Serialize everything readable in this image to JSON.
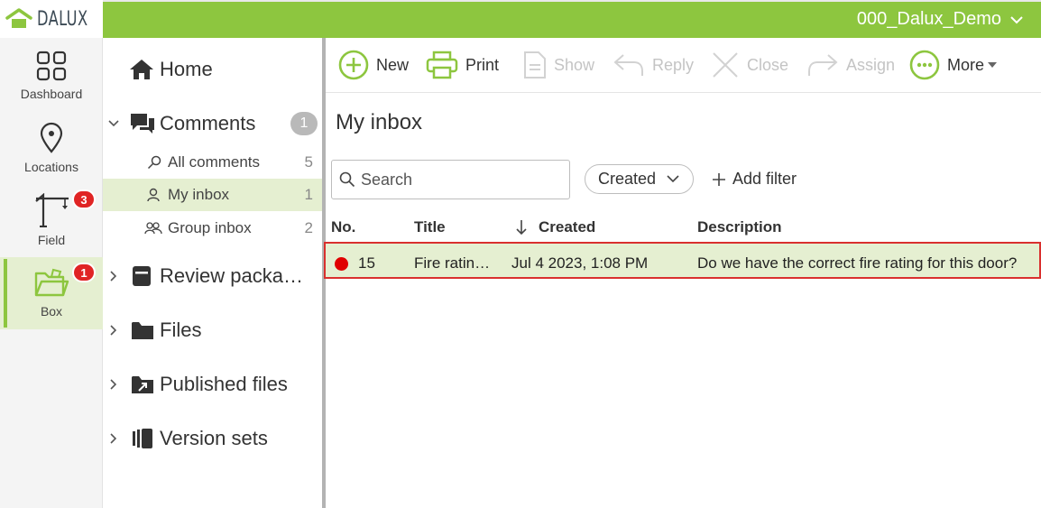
{
  "app": {
    "logo_text": "DALUX",
    "project_name": "000_Dalux_Demo"
  },
  "rail": {
    "items": [
      {
        "label": "Dashboard",
        "icon": "grid-icon"
      },
      {
        "label": "Locations",
        "icon": "map-pin-icon"
      },
      {
        "label": "Field",
        "icon": "crane-icon",
        "badge": "3"
      },
      {
        "label": "Box",
        "icon": "folder-open-icon",
        "badge": "1",
        "active": true
      }
    ]
  },
  "nav": {
    "home": "Home",
    "comments": {
      "label": "Comments",
      "count": "1"
    },
    "all_comments": {
      "label": "All comments",
      "count": "5"
    },
    "my_inbox": {
      "label": "My inbox",
      "count": "1"
    },
    "group_inbox": {
      "label": "Group inbox",
      "count": "2"
    },
    "review_packages": "Review packa…",
    "files": "Files",
    "published_files": "Published files",
    "version_sets": "Version sets"
  },
  "toolbar": {
    "new": "New",
    "print": "Print",
    "show": "Show",
    "reply": "Reply",
    "close": "Close",
    "assign": "Assign",
    "more": "More"
  },
  "main": {
    "title": "My inbox",
    "search_placeholder": "Search",
    "sort_value": "Created",
    "add_filter": "Add filter",
    "columns": {
      "no": "No.",
      "title": "Title",
      "created": "Created",
      "description": "Description"
    },
    "rows": [
      {
        "no": "15",
        "title": "Fire ratin…",
        "created": "Jul 4 2023, 1:08 PM",
        "description": "Do we have the correct fire rating for this door?",
        "status_color": "#e00000"
      }
    ]
  },
  "colors": {
    "brand_green": "#8dc63f",
    "selected_bg": "#e5efd1",
    "badge_red": "#e02424",
    "highlight_border": "#d9302e"
  }
}
